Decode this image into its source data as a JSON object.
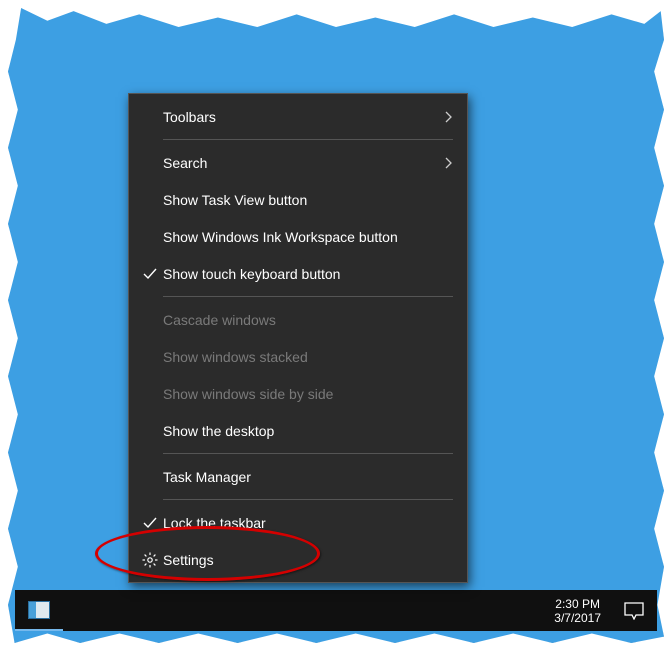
{
  "menu": {
    "items": [
      {
        "label": "Toolbars",
        "submenu": true
      },
      {
        "label": "Search",
        "submenu": true
      },
      {
        "label": "Show Task View button"
      },
      {
        "label": "Show Windows Ink Workspace button"
      },
      {
        "label": "Show touch keyboard button",
        "checked": true
      },
      {
        "label": "Cascade windows",
        "disabled": true
      },
      {
        "label": "Show windows stacked",
        "disabled": true
      },
      {
        "label": "Show windows side by side",
        "disabled": true
      },
      {
        "label": "Show the desktop"
      },
      {
        "label": "Task Manager"
      },
      {
        "label": "Lock the taskbar",
        "checked": true,
        "highlighted": true
      },
      {
        "label": "Settings",
        "icon": "gear"
      }
    ]
  },
  "taskbar": {
    "time": "2:30 PM",
    "date": "3/7/2017"
  },
  "colors": {
    "desktop": "#3d9fe3",
    "menu_bg": "#2b2b2b",
    "highlight": "#d40000"
  }
}
